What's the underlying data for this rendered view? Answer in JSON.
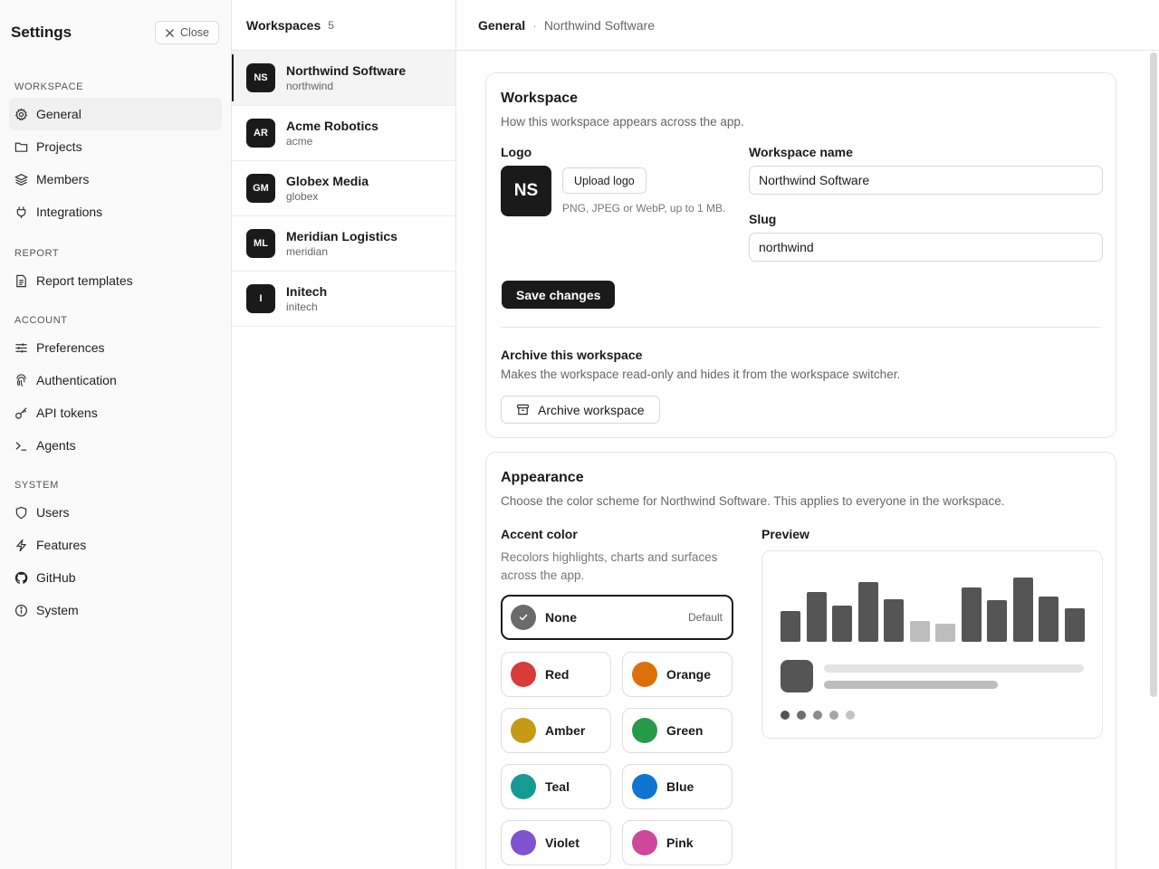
{
  "sidebar": {
    "title": "Settings",
    "close_label": "Close",
    "sections": [
      {
        "label": "WORKSPACE",
        "items": [
          {
            "label": "General",
            "icon": "gear-icon",
            "active": true
          },
          {
            "label": "Projects",
            "icon": "folder-icon"
          },
          {
            "label": "Members",
            "icon": "layers-icon"
          },
          {
            "label": "Integrations",
            "icon": "plug-icon"
          }
        ]
      },
      {
        "label": "REPORT",
        "items": [
          {
            "label": "Report templates",
            "icon": "document-icon"
          }
        ]
      },
      {
        "label": "ACCOUNT",
        "items": [
          {
            "label": "Preferences",
            "icon": "sliders-icon"
          },
          {
            "label": "Authentication",
            "icon": "fingerprint-icon"
          },
          {
            "label": "API tokens",
            "icon": "key-icon"
          },
          {
            "label": "Agents",
            "icon": "terminal-icon"
          }
        ]
      },
      {
        "label": "SYSTEM",
        "items": [
          {
            "label": "Users",
            "icon": "shield-icon"
          },
          {
            "label": "Features",
            "icon": "lightning-icon"
          },
          {
            "label": "GitHub",
            "icon": "github-icon"
          },
          {
            "label": "System",
            "icon": "info-icon"
          }
        ]
      }
    ]
  },
  "workspaces": {
    "title": "Workspaces",
    "count": "5",
    "items": [
      {
        "initials": "NS",
        "name": "Northwind Software",
        "slug": "northwind",
        "active": true
      },
      {
        "initials": "AR",
        "name": "Acme Robotics",
        "slug": "acme"
      },
      {
        "initials": "GM",
        "name": "Globex Media",
        "slug": "globex"
      },
      {
        "initials": "ML",
        "name": "Meridian Logistics",
        "slug": "meridian"
      },
      {
        "initials": "I",
        "name": "Initech",
        "slug": "initech"
      }
    ]
  },
  "header": {
    "crumb": "General",
    "separator": "·",
    "workspace": "Northwind Software"
  },
  "workspace_card": {
    "title": "Workspace",
    "description": "How this workspace appears across the app.",
    "logo_label": "Logo",
    "logo_initials": "NS",
    "upload_label": "Upload logo",
    "upload_hint": "PNG, JPEG or WebP, up to 1 MB.",
    "name_label": "Workspace name",
    "name_value": "Northwind Software",
    "slug_label": "Slug",
    "slug_value": "northwind",
    "save_label": "Save changes",
    "archive_title": "Archive this workspace",
    "archive_desc": "Makes the workspace read-only and hides it from the workspace switcher.",
    "archive_label": "Archive workspace"
  },
  "appearance_card": {
    "title": "Appearance",
    "description": "Choose the color scheme for Northwind Software. This applies to everyone in the workspace.",
    "accent_label": "Accent color",
    "accent_desc": "Recolors highlights, charts and surfaces across the app.",
    "preview_label": "Preview",
    "none_option": {
      "label": "None",
      "badge": "Default",
      "color": "#6b6b6b",
      "selected": true
    },
    "options": [
      {
        "label": "Red",
        "color": "#d93a3a"
      },
      {
        "label": "Orange",
        "color": "#dd6f0b"
      },
      {
        "label": "Amber",
        "color": "#c59b16"
      },
      {
        "label": "Green",
        "color": "#279a4a"
      },
      {
        "label": "Teal",
        "color": "#169a96"
      },
      {
        "label": "Blue",
        "color": "#0f74d2"
      },
      {
        "label": "Violet",
        "color": "#8152cf"
      },
      {
        "label": "Pink",
        "color": "#cd479b"
      }
    ],
    "preview": {
      "bar_heights": [
        0.47,
        0.77,
        0.56,
        0.92,
        0.65,
        0.32,
        0.28,
        0.83,
        0.64,
        0.99,
        0.69,
        0.51
      ],
      "bar_muted": [
        false,
        false,
        false,
        false,
        false,
        true,
        true,
        false,
        false,
        false,
        false,
        false
      ],
      "bar_color": "#555555",
      "bar_muted_color": "#bdbdbd",
      "dot_colors": [
        "#555555",
        "#6e6e6e",
        "#8a8a8a",
        "#a6a6a6",
        "#c2c2c2"
      ]
    }
  }
}
